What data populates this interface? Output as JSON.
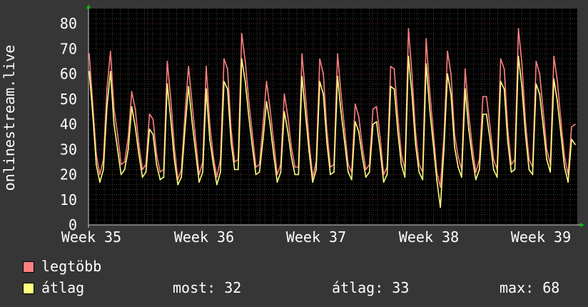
{
  "chart_data": {
    "type": "line",
    "ylabel": "onlinestream.live",
    "ylim": [
      0,
      86
    ],
    "yticks": [
      0,
      10,
      20,
      30,
      40,
      50,
      60,
      70,
      80
    ],
    "x_tick_labels": [
      "Week 35",
      "Week 36",
      "Week 37",
      "Week 38",
      "Week 39"
    ],
    "grid": true,
    "series": [
      {
        "name": "legtöbb",
        "color": "#ff7f7f",
        "values": [
          68,
          48,
          28,
          20,
          26,
          54,
          69,
          46,
          36,
          24,
          25,
          35,
          53,
          46,
          32,
          22,
          24,
          44,
          42,
          28,
          21,
          22,
          65,
          50,
          31,
          18,
          22,
          44,
          63,
          48,
          34,
          20,
          25,
          63,
          40,
          27,
          19,
          26,
          66,
          62,
          38,
          25,
          26,
          76,
          65,
          49,
          36,
          23,
          24,
          40,
          57,
          46,
          33,
          20,
          24,
          52,
          43,
          31,
          23,
          23,
          68,
          51,
          33,
          19,
          25,
          66,
          60,
          38,
          23,
          24,
          68,
          52,
          38,
          24,
          21,
          48,
          43,
          31,
          22,
          24,
          46,
          47,
          35,
          20,
          23,
          63,
          62,
          43,
          28,
          22,
          78,
          60,
          37,
          24,
          21,
          74,
          53,
          37,
          21,
          15,
          35,
          69,
          60,
          36,
          27,
          22,
          62,
          44,
          31,
          21,
          26,
          51,
          51,
          39,
          26,
          22,
          66,
          62,
          38,
          24,
          26,
          78,
          64,
          41,
          26,
          23,
          65,
          60,
          45,
          30,
          24,
          67,
          57,
          41,
          27,
          20,
          39,
          40
        ],
        "labels": [
          "max"
        ]
      },
      {
        "name": "átlag",
        "color": "#ffff7f",
        "values": [
          61,
          44,
          24,
          17,
          22,
          47,
          61,
          40,
          30,
          20,
          22,
          30,
          47,
          39,
          28,
          19,
          21,
          38,
          36,
          24,
          18,
          19,
          56,
          42,
          26,
          16,
          19,
          38,
          55,
          41,
          29,
          17,
          21,
          54,
          34,
          24,
          16,
          21,
          57,
          54,
          33,
          22,
          22,
          66,
          57,
          43,
          31,
          20,
          21,
          34,
          49,
          40,
          28,
          17,
          21,
          45,
          37,
          27,
          20,
          20,
          59,
          44,
          29,
          17,
          22,
          57,
          52,
          33,
          20,
          21,
          59,
          45,
          33,
          21,
          18,
          41,
          37,
          27,
          19,
          21,
          40,
          41,
          30,
          17,
          20,
          55,
          54,
          37,
          24,
          19,
          67,
          52,
          32,
          21,
          18,
          64,
          46,
          32,
          18,
          7,
          30,
          60,
          52,
          31,
          23,
          19,
          54,
          38,
          27,
          18,
          22,
          44,
          44,
          34,
          22,
          19,
          57,
          54,
          33,
          21,
          22,
          67,
          55,
          36,
          22,
          20,
          56,
          52,
          39,
          26,
          21,
          58,
          49,
          36,
          23,
          17,
          34,
          32
        ]
      }
    ],
    "legend": {
      "series1_label": "legtöbb",
      "series2_label": "átlag",
      "series1_color": "#ff7f7f",
      "series2_color": "#ffff7f",
      "now_label": "most:",
      "now_value": "32",
      "avg_label": "átlag:",
      "avg_value": "33",
      "max_label": "max:",
      "max_value": "68"
    }
  }
}
